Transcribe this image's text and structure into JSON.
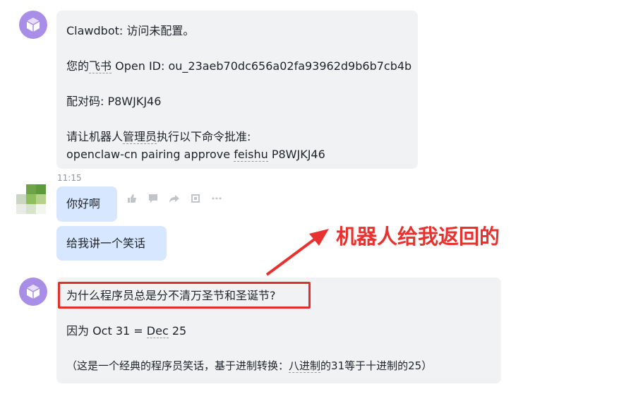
{
  "messages": {
    "bot1": {
      "line1": "Clawdbot: 访问未配置。",
      "line2_prefix": "您的",
      "line2_link": "飞书",
      "line2_suffix": " Open ID: ou_23aeb70dc656a02fa93962d9b6b7cb4b",
      "line3": "配对码: P8WJKJ46",
      "line4_a": "请让机器人",
      "line4_link": "管理员",
      "line4_b": "执行以下命令批准:",
      "line5_prefix": "openclaw-cn pairing approve ",
      "line5_link": "feishu",
      "line5_suffix": " P8WJKJ46"
    },
    "timestamp": "11:15",
    "user1": "你好啊",
    "user2": "给我讲一个笑话",
    "bot2": {
      "question": "为什么程序员总是分不清万圣节和圣诞节?",
      "answer_prefix": "因为 Oct 31 = ",
      "answer_link": "Dec",
      "answer_suffix": " 25",
      "note_prefix": "（这是一个经典的程序员笑话，基于进制转换：",
      "note_link": "八进制",
      "note_suffix": "的31等于十进制的25）"
    }
  },
  "annotation": {
    "text": "机器人给我返回的",
    "color": "#e8322f"
  },
  "colors": {
    "bot_avatar": "#a98ee8",
    "bot_bubble": "#f1f2f3",
    "user_bubble": "#d7e7ff"
  },
  "icons": {
    "bot_avatar": "cube-icon",
    "toolbar": [
      "thumbs-up-icon",
      "comment-icon",
      "forward-icon",
      "quote-icon",
      "more-icon"
    ]
  }
}
